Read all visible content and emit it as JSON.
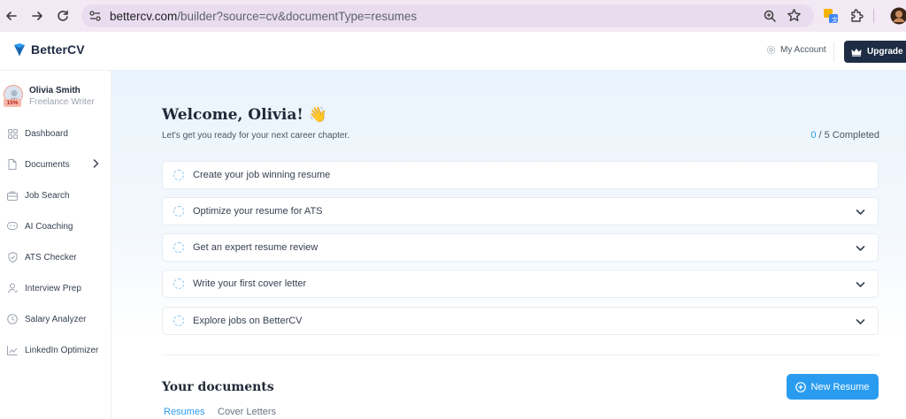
{
  "browser": {
    "url_host": "bettercv.com",
    "url_path": "/builder?source=cv&documentType=resumes"
  },
  "header": {
    "logo_text": "BetterCV",
    "my_account": "My Account",
    "upgrade_label": "Upgrade N"
  },
  "profile": {
    "name": "Olivia Smith",
    "role": "Freelance Writer",
    "completion_badge": "15%"
  },
  "sidebar": {
    "items": [
      {
        "label": "Dashboard",
        "icon": "grid-icon"
      },
      {
        "label": "Documents",
        "icon": "document-icon",
        "has_chevron": true
      },
      {
        "label": "Job Search",
        "icon": "briefcase-icon"
      },
      {
        "label": "AI Coaching",
        "icon": "ai-chat-icon"
      },
      {
        "label": "ATS Checker",
        "icon": "shield-check-icon"
      },
      {
        "label": "Interview Prep",
        "icon": "person-icon"
      },
      {
        "label": "Salary Analyzer",
        "icon": "clock-icon"
      },
      {
        "label": "LinkedIn Optimizer",
        "icon": "trend-chart-icon"
      }
    ]
  },
  "main": {
    "welcome": "Welcome, Olivia! 👋",
    "subtitle": "Let's get you ready for your next career chapter.",
    "progress_done": "0",
    "progress_rest": " / 5 Completed",
    "tasks": [
      {
        "label": "Create your job winning resume",
        "expandable": false
      },
      {
        "label": "Optimize your resume for ATS",
        "expandable": true
      },
      {
        "label": "Get an expert resume review",
        "expandable": true
      },
      {
        "label": "Write your first cover letter",
        "expandable": true
      },
      {
        "label": "Explore jobs on BetterCV",
        "expandable": true
      }
    ],
    "documents_title": "Your documents",
    "new_resume_label": "New Resume",
    "tabs": [
      {
        "label": "Resumes",
        "active": true
      },
      {
        "label": "Cover Letters",
        "active": false
      }
    ]
  },
  "colors": {
    "accent": "#2a9cf0",
    "upgrade_bg": "#1e2d45"
  }
}
